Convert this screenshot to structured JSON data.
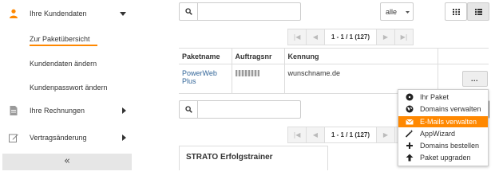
{
  "colors": {
    "accent": "#ff8800",
    "link": "#336699",
    "text": "#333333",
    "muted_bg": "#e6e6e6"
  },
  "sidebar": {
    "section_customer": {
      "label": "Ihre Kundendaten",
      "icon": "user-icon"
    },
    "sub_items": [
      {
        "label": "Zur Paketübersicht"
      },
      {
        "label": "Kundendaten ändern"
      },
      {
        "label": "Kundenpasswort ändern"
      }
    ],
    "section_invoices": {
      "label": "Ihre Rechnungen",
      "icon": "document-icon"
    },
    "section_contract": {
      "label": "Vertragsänderung",
      "icon": "edit-icon"
    },
    "collapse_label": "«"
  },
  "toolbar": {
    "search_value": "",
    "filter_select": "alle",
    "view_grid_icon": "grid-icon",
    "view_list_icon": "list-icon"
  },
  "pager_top": {
    "first": "|◀",
    "prev": "◀",
    "info": "1 - 1 / 1 (127)",
    "next": "▶",
    "last": "▶|"
  },
  "table": {
    "columns": [
      "Paketname",
      "Auftragsnr",
      "Kennung",
      ""
    ],
    "rows": [
      {
        "paketname": "PowerWeb Plus",
        "auftragsnr": "",
        "kennung": "wunschname.de",
        "action": "..."
      }
    ]
  },
  "search2_value": "",
  "pager_bottom": {
    "first": "|◀",
    "prev": "◀",
    "info": "1 - 1 / 1 (127)",
    "next": "▶",
    "last": "▶|"
  },
  "context_menu": [
    {
      "label": "Ihr Paket",
      "icon": "disk-icon"
    },
    {
      "label": "Domains verwalten",
      "icon": "globe-icon"
    },
    {
      "label": "E-Mails verwalten",
      "icon": "envelope-icon",
      "active": true
    },
    {
      "label": "AppWizard",
      "icon": "wand-icon"
    },
    {
      "label": "Domains bestellen",
      "icon": "plus-icon"
    },
    {
      "label": "Paket upgraden",
      "icon": "arrow-up-icon"
    }
  ],
  "trainer": {
    "title": "STRATO Erfolgstrainer"
  }
}
